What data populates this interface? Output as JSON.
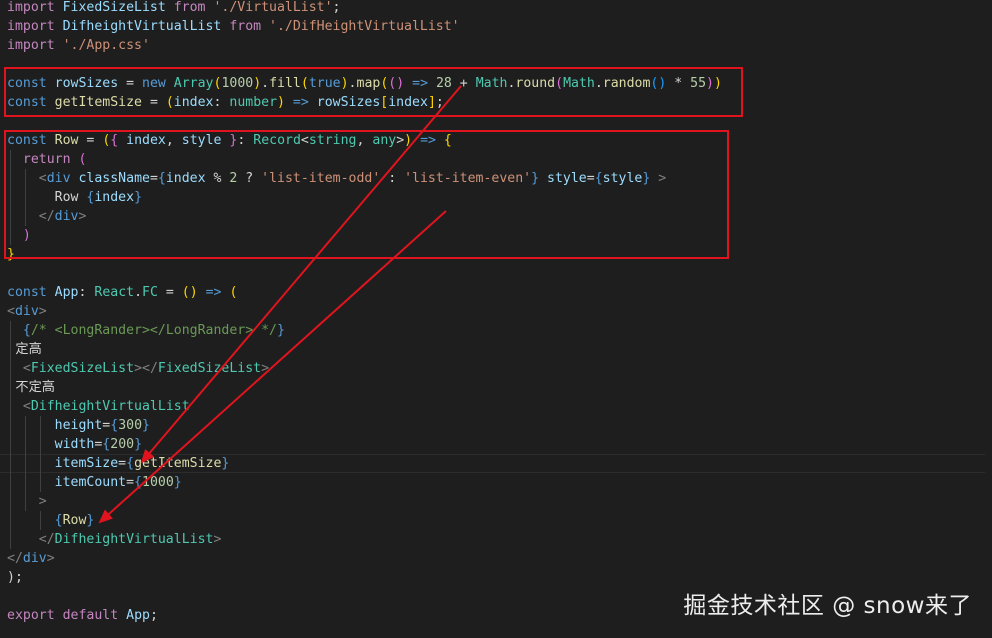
{
  "colors": {
    "background": "#1e1e1e",
    "keyword_import": "#c586c0",
    "keyword": "#569cd6",
    "identifier": "#9cdcfe",
    "function": "#dcdcaa",
    "type": "#4ec9b0",
    "string": "#ce9178",
    "number": "#b5cea8",
    "jsx_tag": "#569cd6",
    "component_tag": "#4ec9b0",
    "punctuation": "#808080",
    "comment": "#6a9955",
    "plain": "#d4d4d4",
    "bracket_gold": "#ffd700",
    "bracket_purple": "#da70d6",
    "bracket_blue": "#179fff",
    "annotation_red": "#e0141e"
  },
  "code_lines": [
    {
      "tokens": [
        {
          "t": "import",
          "c": "keyword_import"
        },
        {
          "t": " FixedSizeList ",
          "c": "identifier"
        },
        {
          "t": "from",
          "c": "keyword_import"
        },
        {
          "t": " ",
          "c": "plain"
        },
        {
          "t": "'./VirtualList'",
          "c": "string"
        },
        {
          "t": ";",
          "c": "plain"
        }
      ]
    },
    {
      "tokens": [
        {
          "t": "import",
          "c": "keyword_import"
        },
        {
          "t": " DifheightVirtualList ",
          "c": "identifier"
        },
        {
          "t": "from",
          "c": "keyword_import"
        },
        {
          "t": " ",
          "c": "plain"
        },
        {
          "t": "'./DifHeightVirtualList'",
          "c": "string"
        }
      ]
    },
    {
      "tokens": [
        {
          "t": "import",
          "c": "keyword_import"
        },
        {
          "t": " ",
          "c": "plain"
        },
        {
          "t": "'./App.css'",
          "c": "string"
        }
      ]
    },
    {
      "tokens": []
    },
    {
      "tokens": [
        {
          "t": "const",
          "c": "keyword"
        },
        {
          "t": " rowSizes ",
          "c": "identifier"
        },
        {
          "t": "= ",
          "c": "plain"
        },
        {
          "t": "new",
          "c": "keyword"
        },
        {
          "t": " ",
          "c": "plain"
        },
        {
          "t": "Array",
          "c": "type"
        },
        {
          "t": "(",
          "c": "bracket_gold"
        },
        {
          "t": "1000",
          "c": "number"
        },
        {
          "t": ")",
          "c": "bracket_gold"
        },
        {
          "t": ".",
          "c": "plain"
        },
        {
          "t": "fill",
          "c": "function"
        },
        {
          "t": "(",
          "c": "bracket_gold"
        },
        {
          "t": "true",
          "c": "keyword"
        },
        {
          "t": ")",
          "c": "bracket_gold"
        },
        {
          "t": ".",
          "c": "plain"
        },
        {
          "t": "map",
          "c": "function"
        },
        {
          "t": "(",
          "c": "bracket_gold"
        },
        {
          "t": "()",
          "c": "bracket_purple"
        },
        {
          "t": " ",
          "c": "plain"
        },
        {
          "t": "=>",
          "c": "keyword"
        },
        {
          "t": " ",
          "c": "plain"
        },
        {
          "t": "28",
          "c": "number"
        },
        {
          "t": " + ",
          "c": "plain"
        },
        {
          "t": "Math",
          "c": "type"
        },
        {
          "t": ".",
          "c": "plain"
        },
        {
          "t": "round",
          "c": "function"
        },
        {
          "t": "(",
          "c": "bracket_purple"
        },
        {
          "t": "Math",
          "c": "type"
        },
        {
          "t": ".",
          "c": "plain"
        },
        {
          "t": "random",
          "c": "function"
        },
        {
          "t": "()",
          "c": "bracket_blue"
        },
        {
          "t": " * ",
          "c": "plain"
        },
        {
          "t": "55",
          "c": "number"
        },
        {
          "t": ")",
          "c": "bracket_purple"
        },
        {
          "t": ")",
          "c": "bracket_gold"
        }
      ]
    },
    {
      "tokens": [
        {
          "t": "const",
          "c": "keyword"
        },
        {
          "t": " ",
          "c": "plain"
        },
        {
          "t": "getItemSize",
          "c": "function"
        },
        {
          "t": " = ",
          "c": "plain"
        },
        {
          "t": "(",
          "c": "bracket_gold"
        },
        {
          "t": "index",
          "c": "identifier"
        },
        {
          "t": ": ",
          "c": "plain"
        },
        {
          "t": "number",
          "c": "type"
        },
        {
          "t": ")",
          "c": "bracket_gold"
        },
        {
          "t": " ",
          "c": "plain"
        },
        {
          "t": "=>",
          "c": "keyword"
        },
        {
          "t": " rowSizes",
          "c": "identifier"
        },
        {
          "t": "[",
          "c": "bracket_gold"
        },
        {
          "t": "index",
          "c": "identifier"
        },
        {
          "t": "]",
          "c": "bracket_gold"
        },
        {
          "t": ";",
          "c": "plain"
        }
      ]
    },
    {
      "tokens": []
    },
    {
      "tokens": [
        {
          "t": "const",
          "c": "keyword"
        },
        {
          "t": " ",
          "c": "plain"
        },
        {
          "t": "Row",
          "c": "function"
        },
        {
          "t": " = ",
          "c": "plain"
        },
        {
          "t": "(",
          "c": "bracket_gold"
        },
        {
          "t": "{",
          "c": "bracket_purple"
        },
        {
          "t": " index",
          "c": "identifier"
        },
        {
          "t": ", ",
          "c": "plain"
        },
        {
          "t": "style",
          "c": "identifier"
        },
        {
          "t": " ",
          "c": "plain"
        },
        {
          "t": "}",
          "c": "bracket_purple"
        },
        {
          "t": ": ",
          "c": "plain"
        },
        {
          "t": "Record",
          "c": "type"
        },
        {
          "t": "<",
          "c": "plain"
        },
        {
          "t": "string",
          "c": "type"
        },
        {
          "t": ", ",
          "c": "plain"
        },
        {
          "t": "any",
          "c": "type"
        },
        {
          "t": ">",
          "c": "plain"
        },
        {
          "t": ")",
          "c": "bracket_gold"
        },
        {
          "t": " ",
          "c": "plain"
        },
        {
          "t": "=>",
          "c": "keyword"
        },
        {
          "t": " ",
          "c": "plain"
        },
        {
          "t": "{",
          "c": "bracket_gold"
        }
      ]
    },
    {
      "tokens": [
        {
          "t": "  ",
          "c": "plain"
        },
        {
          "t": "return",
          "c": "keyword_import"
        },
        {
          "t": " ",
          "c": "plain"
        },
        {
          "t": "(",
          "c": "bracket_purple"
        }
      ]
    },
    {
      "tokens": [
        {
          "t": "    ",
          "c": "plain"
        },
        {
          "t": "<",
          "c": "punctuation"
        },
        {
          "t": "div",
          "c": "jsx_tag"
        },
        {
          "t": " className",
          "c": "identifier"
        },
        {
          "t": "=",
          "c": "plain"
        },
        {
          "t": "{",
          "c": "keyword"
        },
        {
          "t": "index",
          "c": "identifier"
        },
        {
          "t": " % ",
          "c": "plain"
        },
        {
          "t": "2",
          "c": "number"
        },
        {
          "t": " ? ",
          "c": "plain"
        },
        {
          "t": "'list-item-odd'",
          "c": "string"
        },
        {
          "t": " : ",
          "c": "plain"
        },
        {
          "t": "'list-item-even'",
          "c": "string"
        },
        {
          "t": "}",
          "c": "keyword"
        },
        {
          "t": " style",
          "c": "identifier"
        },
        {
          "t": "=",
          "c": "plain"
        },
        {
          "t": "{",
          "c": "keyword"
        },
        {
          "t": "style",
          "c": "identifier"
        },
        {
          "t": "}",
          "c": "keyword"
        },
        {
          "t": " ",
          "c": "plain"
        },
        {
          "t": ">",
          "c": "punctuation"
        }
      ]
    },
    {
      "tokens": [
        {
          "t": "      Row ",
          "c": "plain"
        },
        {
          "t": "{",
          "c": "keyword"
        },
        {
          "t": "index",
          "c": "identifier"
        },
        {
          "t": "}",
          "c": "keyword"
        }
      ]
    },
    {
      "tokens": [
        {
          "t": "    ",
          "c": "plain"
        },
        {
          "t": "</",
          "c": "punctuation"
        },
        {
          "t": "div",
          "c": "jsx_tag"
        },
        {
          "t": ">",
          "c": "punctuation"
        }
      ]
    },
    {
      "tokens": [
        {
          "t": "  ",
          "c": "plain"
        },
        {
          "t": ")",
          "c": "bracket_purple"
        }
      ]
    },
    {
      "tokens": [
        {
          "t": "}",
          "c": "bracket_gold"
        }
      ]
    },
    {
      "tokens": []
    },
    {
      "tokens": [
        {
          "t": "const",
          "c": "keyword"
        },
        {
          "t": " ",
          "c": "plain"
        },
        {
          "t": "App",
          "c": "identifier"
        },
        {
          "t": ": ",
          "c": "plain"
        },
        {
          "t": "React",
          "c": "type"
        },
        {
          "t": ".",
          "c": "plain"
        },
        {
          "t": "FC",
          "c": "type"
        },
        {
          "t": " = ",
          "c": "plain"
        },
        {
          "t": "()",
          "c": "bracket_gold"
        },
        {
          "t": " ",
          "c": "plain"
        },
        {
          "t": "=>",
          "c": "keyword"
        },
        {
          "t": " ",
          "c": "plain"
        },
        {
          "t": "(",
          "c": "bracket_gold"
        }
      ]
    },
    {
      "tokens": [
        {
          "t": "<",
          "c": "punctuation"
        },
        {
          "t": "div",
          "c": "jsx_tag"
        },
        {
          "t": ">",
          "c": "punctuation"
        }
      ]
    },
    {
      "tokens": [
        {
          "t": "  ",
          "c": "plain"
        },
        {
          "t": "{",
          "c": "keyword"
        },
        {
          "t": "/* <LongRander></LongRander> */",
          "c": "comment"
        },
        {
          "t": "}",
          "c": "keyword"
        }
      ]
    },
    {
      "tokens": [
        {
          "t": "  定高",
          "c": "plain",
          "cjk": true
        }
      ]
    },
    {
      "tokens": [
        {
          "t": "  ",
          "c": "plain"
        },
        {
          "t": "<",
          "c": "punctuation"
        },
        {
          "t": "FixedSizeList",
          "c": "component_tag"
        },
        {
          "t": "></",
          "c": "punctuation"
        },
        {
          "t": "FixedSizeList",
          "c": "component_tag"
        },
        {
          "t": ">",
          "c": "punctuation"
        }
      ]
    },
    {
      "tokens": [
        {
          "t": "  不定高",
          "c": "plain",
          "cjk": true
        }
      ]
    },
    {
      "tokens": [
        {
          "t": "  ",
          "c": "plain"
        },
        {
          "t": "<",
          "c": "punctuation"
        },
        {
          "t": "DifheightVirtualList",
          "c": "component_tag"
        }
      ]
    },
    {
      "tokens": [
        {
          "t": "      height",
          "c": "identifier"
        },
        {
          "t": "=",
          "c": "plain"
        },
        {
          "t": "{",
          "c": "keyword"
        },
        {
          "t": "300",
          "c": "number"
        },
        {
          "t": "}",
          "c": "keyword"
        }
      ]
    },
    {
      "tokens": [
        {
          "t": "      width",
          "c": "identifier"
        },
        {
          "t": "=",
          "c": "plain"
        },
        {
          "t": "{",
          "c": "keyword"
        },
        {
          "t": "200",
          "c": "number"
        },
        {
          "t": "}",
          "c": "keyword"
        }
      ]
    },
    {
      "current": true,
      "tokens": [
        {
          "t": "      itemSize",
          "c": "identifier"
        },
        {
          "t": "=",
          "c": "plain"
        },
        {
          "t": "{",
          "c": "keyword"
        },
        {
          "t": "getItemSize",
          "c": "function"
        },
        {
          "t": "}",
          "c": "keyword"
        }
      ]
    },
    {
      "tokens": [
        {
          "t": "      itemCount",
          "c": "identifier"
        },
        {
          "t": "=",
          "c": "plain"
        },
        {
          "t": "{",
          "c": "keyword"
        },
        {
          "t": "1000",
          "c": "number"
        },
        {
          "t": "}",
          "c": "keyword"
        }
      ]
    },
    {
      "tokens": [
        {
          "t": "    ",
          "c": "plain"
        },
        {
          "t": ">",
          "c": "punctuation"
        }
      ]
    },
    {
      "tokens": [
        {
          "t": "      ",
          "c": "plain"
        },
        {
          "t": "{",
          "c": "keyword"
        },
        {
          "t": "Row",
          "c": "function"
        },
        {
          "t": "}",
          "c": "keyword"
        }
      ]
    },
    {
      "tokens": [
        {
          "t": "    ",
          "c": "plain"
        },
        {
          "t": "</",
          "c": "punctuation"
        },
        {
          "t": "DifheightVirtualList",
          "c": "component_tag"
        },
        {
          "t": ">",
          "c": "punctuation"
        }
      ]
    },
    {
      "tokens": [
        {
          "t": "</",
          "c": "punctuation"
        },
        {
          "t": "div",
          "c": "jsx_tag"
        },
        {
          "t": ">",
          "c": "punctuation"
        }
      ]
    },
    {
      "tokens": [
        {
          "t": ");",
          "c": "plain"
        }
      ]
    },
    {
      "tokens": []
    },
    {
      "tokens": [
        {
          "t": "export",
          "c": "keyword_import"
        },
        {
          "t": " ",
          "c": "plain"
        },
        {
          "t": "default",
          "c": "keyword_import"
        },
        {
          "t": " ",
          "c": "plain"
        },
        {
          "t": "App",
          "c": "identifier"
        },
        {
          "t": ";",
          "c": "plain"
        }
      ]
    }
  ],
  "watermark": {
    "text": "掘金技术社区 @ snow来了"
  }
}
